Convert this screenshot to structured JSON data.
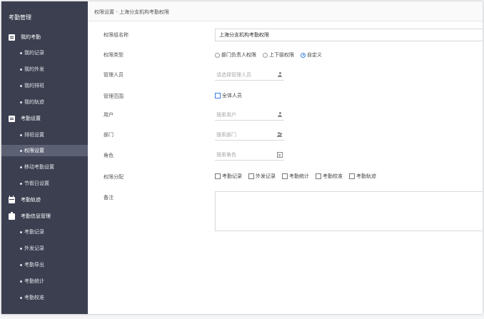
{
  "sidebar": {
    "title": "考勤管理",
    "groups": [
      {
        "label": "我的考勤",
        "icon": "document-icon"
      },
      {
        "label": "考勤设置",
        "icon": "document-icon"
      },
      {
        "label": "考勤轨迹",
        "icon": "calendar-icon"
      },
      {
        "label": "考勤信息管理",
        "icon": "clipboard-icon"
      }
    ],
    "items": [
      {
        "label": "我的记录"
      },
      {
        "label": "我的外发"
      },
      {
        "label": "我的排班"
      },
      {
        "label": "我的轨迹"
      },
      {
        "label": "排班设置"
      },
      {
        "label": "权限设置"
      },
      {
        "label": "移动考勤设置"
      },
      {
        "label": "节假日设置"
      },
      {
        "label": "考勤记录"
      },
      {
        "label": "外发记录"
      },
      {
        "label": "考勤导出"
      },
      {
        "label": "考勤统计"
      },
      {
        "label": "考勤校准"
      }
    ]
  },
  "header": {
    "breadcrumb": "权限设置 - 上海分支机构考勤权限"
  },
  "form": {
    "group_name": {
      "label": "权限组名称",
      "value": "上海分支机构考勤权限"
    },
    "perm_type": {
      "label": "权限类型",
      "options": [
        "部门负责人权限",
        "上下级权限",
        "自定义"
      ],
      "selected": "自定义"
    },
    "managers": {
      "label": "管理人员",
      "placeholder": "请选择管理人员",
      "icon": "user-icon"
    },
    "scope": {
      "label": "管理范围",
      "checkbox": "全体人员"
    },
    "users": {
      "label": "用户",
      "placeholder": "搜索用户",
      "icon": "user-icon"
    },
    "dept": {
      "label": "部门",
      "placeholder": "搜索部门",
      "icon": "group-icon"
    },
    "role": {
      "label": "角色",
      "placeholder": "搜索角色",
      "icon": "id-card-icon"
    },
    "assign": {
      "label": "权限分配",
      "options": [
        "考勤记录",
        "外发记录",
        "考勤统计",
        "考勤校准",
        "考勤轨迹"
      ]
    },
    "remark": {
      "label": "备注"
    }
  },
  "colors": {
    "sidebar_bg": "#3b3f50",
    "active_item": "#5b6073",
    "accent": "#3b7ddd"
  }
}
